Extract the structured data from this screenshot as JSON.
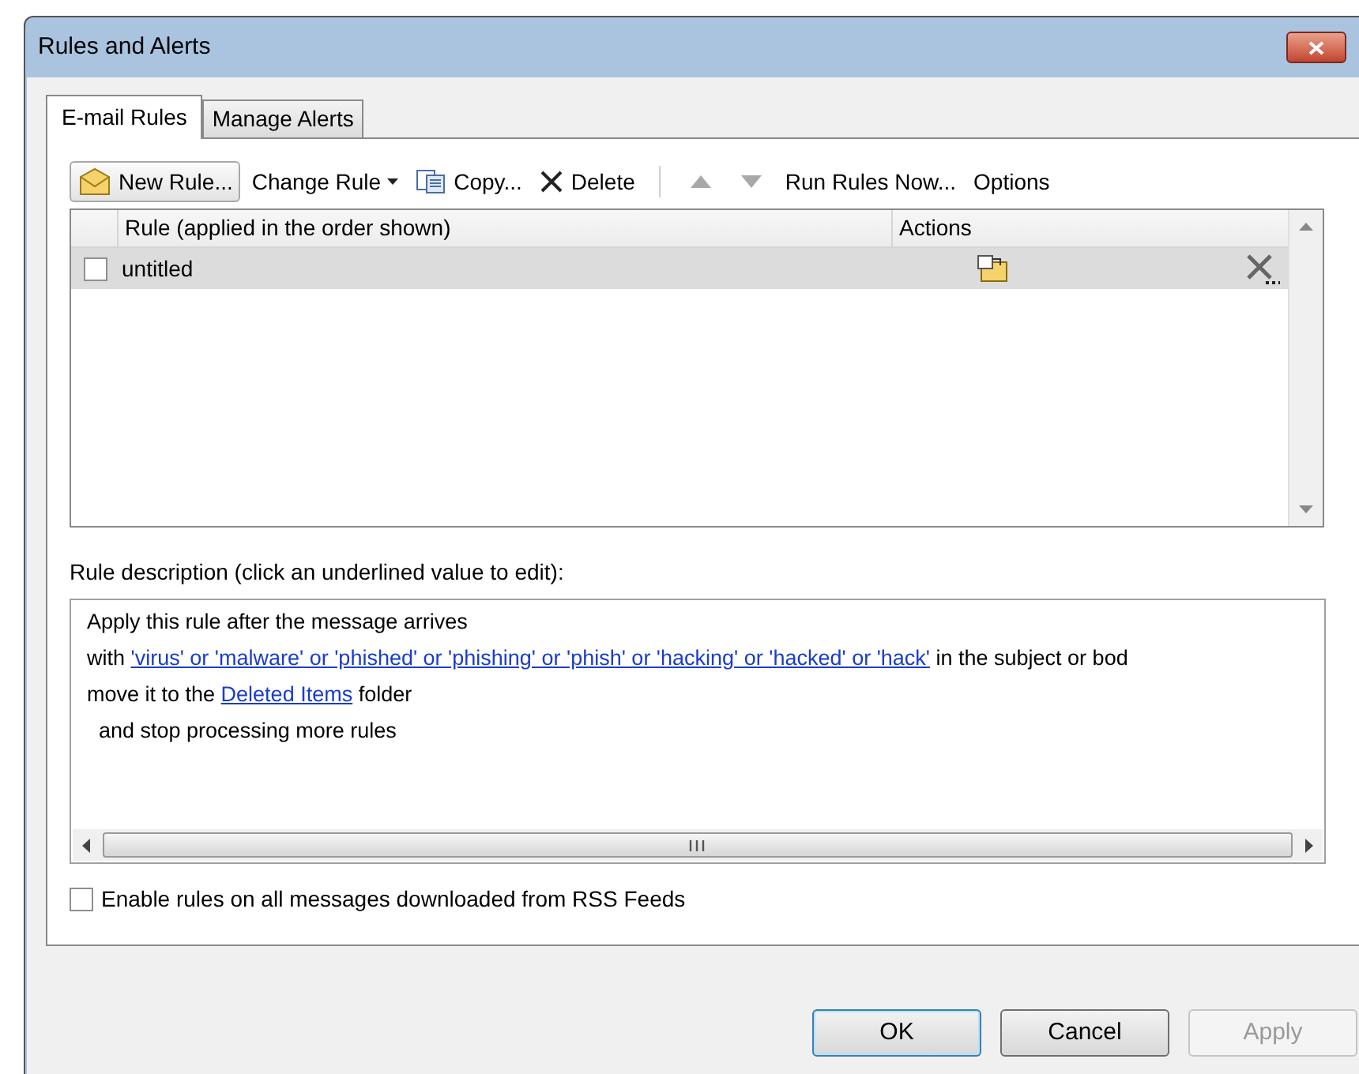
{
  "window": {
    "title": "Rules and Alerts"
  },
  "tabs": [
    {
      "label": "E-mail Rules",
      "selected": true
    },
    {
      "label": "Manage Alerts",
      "selected": false
    }
  ],
  "toolbar": [
    {
      "kind": "new",
      "label": "New Rule..."
    },
    {
      "kind": "dropdown",
      "label": "Change Rule"
    },
    {
      "kind": "copy",
      "label": "Copy..."
    },
    {
      "kind": "delete",
      "label": "Delete"
    },
    {
      "kind": "separator"
    },
    {
      "kind": "up",
      "disabled": true
    },
    {
      "kind": "down",
      "disabled": true
    },
    {
      "kind": "text",
      "label": "Run Rules Now..."
    },
    {
      "kind": "text",
      "label": "Options"
    }
  ],
  "rules": {
    "columns": [
      "Rule (applied in the order shown)",
      "Actions"
    ],
    "rows": [
      {
        "name": "untitled",
        "checked": false,
        "selected": true
      }
    ]
  },
  "description": {
    "label": "Rule description (click an underlined value to edit):",
    "lines": [
      [
        {
          "text": "Apply this rule after the message arrives",
          "link": false
        }
      ],
      [
        {
          "text": "with ",
          "link": false
        },
        {
          "text": "'virus' or 'malware' or 'phished' or 'phishing' or 'phish' or 'hacking' or 'hacked' or 'hack'",
          "link": true
        },
        {
          "text": " in the subject or bod",
          "link": false
        }
      ],
      [
        {
          "text": "move it to the ",
          "link": false
        },
        {
          "text": "Deleted Items",
          "link": true
        },
        {
          "text": " folder",
          "link": false
        }
      ],
      [
        {
          "text": "  and stop processing more rules",
          "link": false
        }
      ]
    ]
  },
  "rss_option": {
    "label": "Enable rules on all messages downloaded from RSS Feeds",
    "checked": false
  },
  "buttons": [
    {
      "label": "OK",
      "default": true,
      "disabled": false
    },
    {
      "label": "Cancel",
      "default": false,
      "disabled": false
    },
    {
      "label": "Apply",
      "default": false,
      "disabled": true
    }
  ]
}
